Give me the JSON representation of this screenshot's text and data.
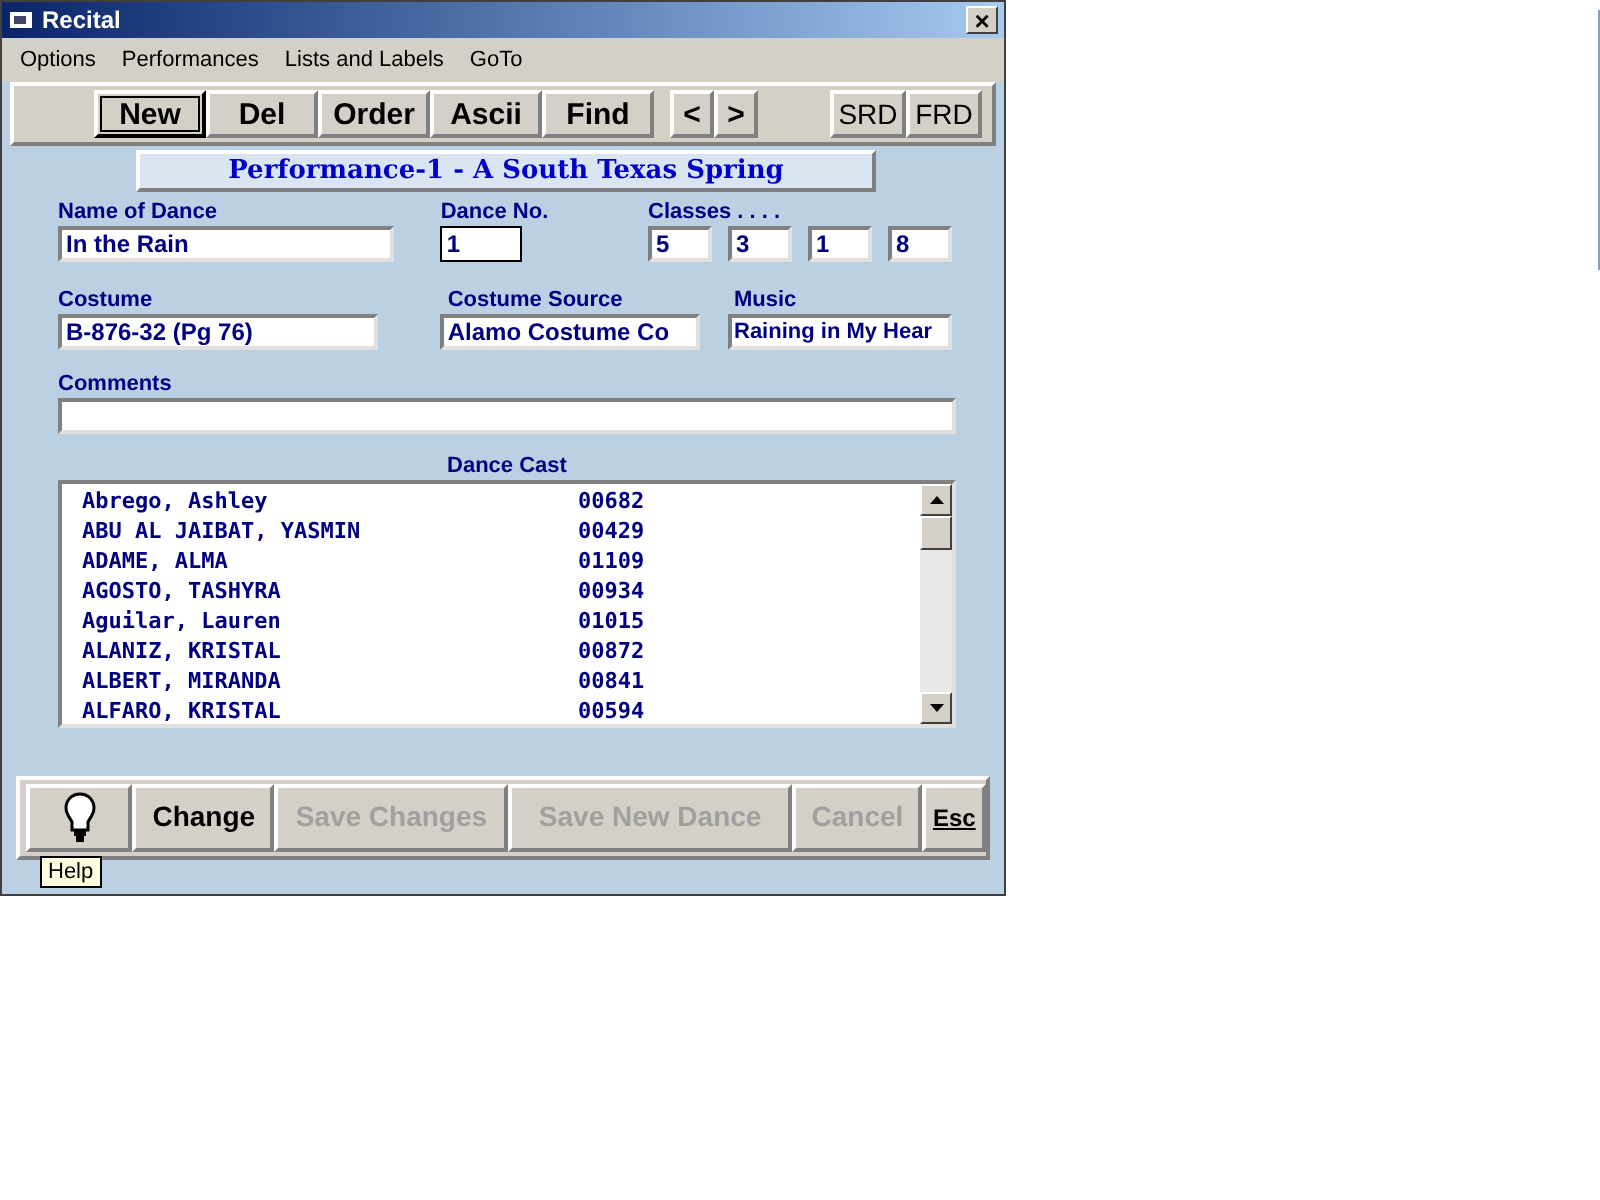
{
  "window": {
    "title": "Recital",
    "close": "×"
  },
  "menu": [
    "Options",
    "Performances",
    "Lists and Labels",
    "GoTo"
  ],
  "toolbar": [
    {
      "kind": "record",
      "buttons": [
        {
          "label": "New",
          "focused": true
        },
        {
          "label": "Del",
          "focused": false
        },
        {
          "label": "Order",
          "focused": false
        },
        {
          "label": "Ascii",
          "focused": false
        },
        {
          "label": "Find",
          "focused": false
        }
      ]
    },
    {
      "kind": "nav",
      "buttons": [
        {
          "label": "<",
          "focused": false
        },
        {
          "label": ">",
          "focused": false
        }
      ]
    },
    {
      "kind": "report",
      "buttons": [
        {
          "label": "SRD",
          "focused": false
        },
        {
          "label": "FRD",
          "focused": false
        }
      ]
    }
  ],
  "performance_title": "Performance-1 - A South Texas Spring",
  "name_of_dance": {
    "label": "Name of Dance",
    "value": "In the Rain"
  },
  "dance_no": {
    "label": "Dance No.",
    "value": "1"
  },
  "classes": {
    "label": "Classes . . . .",
    "values": [
      "5",
      "3",
      "1",
      "8"
    ]
  },
  "costume": {
    "label": "Costume",
    "value": "B-876-32 (Pg 76)"
  },
  "costume_source": {
    "label": "Costume Source",
    "value": "Alamo Costume Co"
  },
  "music": {
    "label": "Music",
    "value": "Raining in My Hear"
  },
  "comments": {
    "label": "Comments"
  },
  "dance_cast": {
    "label": "Dance Cast",
    "rows": [
      {
        "name": "Abrego, Ashley",
        "id": "00682"
      },
      {
        "name": "ABU AL JAIBAT, YASMIN",
        "id": "00429"
      },
      {
        "name": "ADAME, ALMA",
        "id": "01109"
      },
      {
        "name": "AGOSTO, TASHYRA",
        "id": "00934"
      },
      {
        "name": "Aguilar, Lauren",
        "id": "01015"
      },
      {
        "name": "ALANIZ, KRISTAL",
        "id": "00872"
      },
      {
        "name": "ALBERT, MIRANDA",
        "id": "00841"
      },
      {
        "name": "ALFARO, KRISTAL",
        "id": "00594"
      }
    ]
  },
  "bottom_buttons": [
    {
      "kind": "icon",
      "disabled": false
    },
    {
      "kind": "text",
      "label": "Change",
      "disabled": false
    },
    {
      "kind": "text",
      "label": "Save Changes",
      "disabled": true
    },
    {
      "kind": "text",
      "label": "Save New Dance",
      "disabled": true
    },
    {
      "kind": "text",
      "label": "Cancel",
      "disabled": true
    },
    {
      "kind": "small",
      "label": "Esc",
      "disabled": false
    }
  ],
  "tooltip": "Help"
}
